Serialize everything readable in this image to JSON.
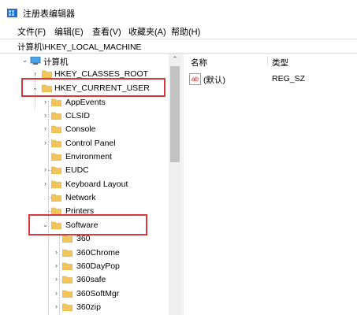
{
  "window": {
    "title": "注册表编辑器"
  },
  "menu": [
    "文件(F)",
    "编辑(E)",
    "查看(V)",
    "收藏夹(A)",
    "帮助(H)"
  ],
  "address": "计算机\\HKEY_LOCAL_MACHINE",
  "tree": {
    "root": "计算机",
    "items": [
      "HKEY_CLASSES_ROOT",
      "HKEY_CURRENT_USER",
      "AppEvents",
      "CLSID",
      "Console",
      "Control Panel",
      "Environment",
      "EUDC",
      "Keyboard Layout",
      "Network",
      "Printers",
      "Software",
      "360",
      "360Chrome",
      "360DayPop",
      "360safe",
      "360SoftMgr",
      "360zip"
    ]
  },
  "list": {
    "columns": [
      "名称",
      "类型"
    ],
    "rows": [
      {
        "name": "(默认)",
        "type": "REG_SZ",
        "icon": "ab-string-icon"
      }
    ]
  },
  "colors": {
    "highlight": "#d9383a",
    "folder": "#f2c55c"
  }
}
